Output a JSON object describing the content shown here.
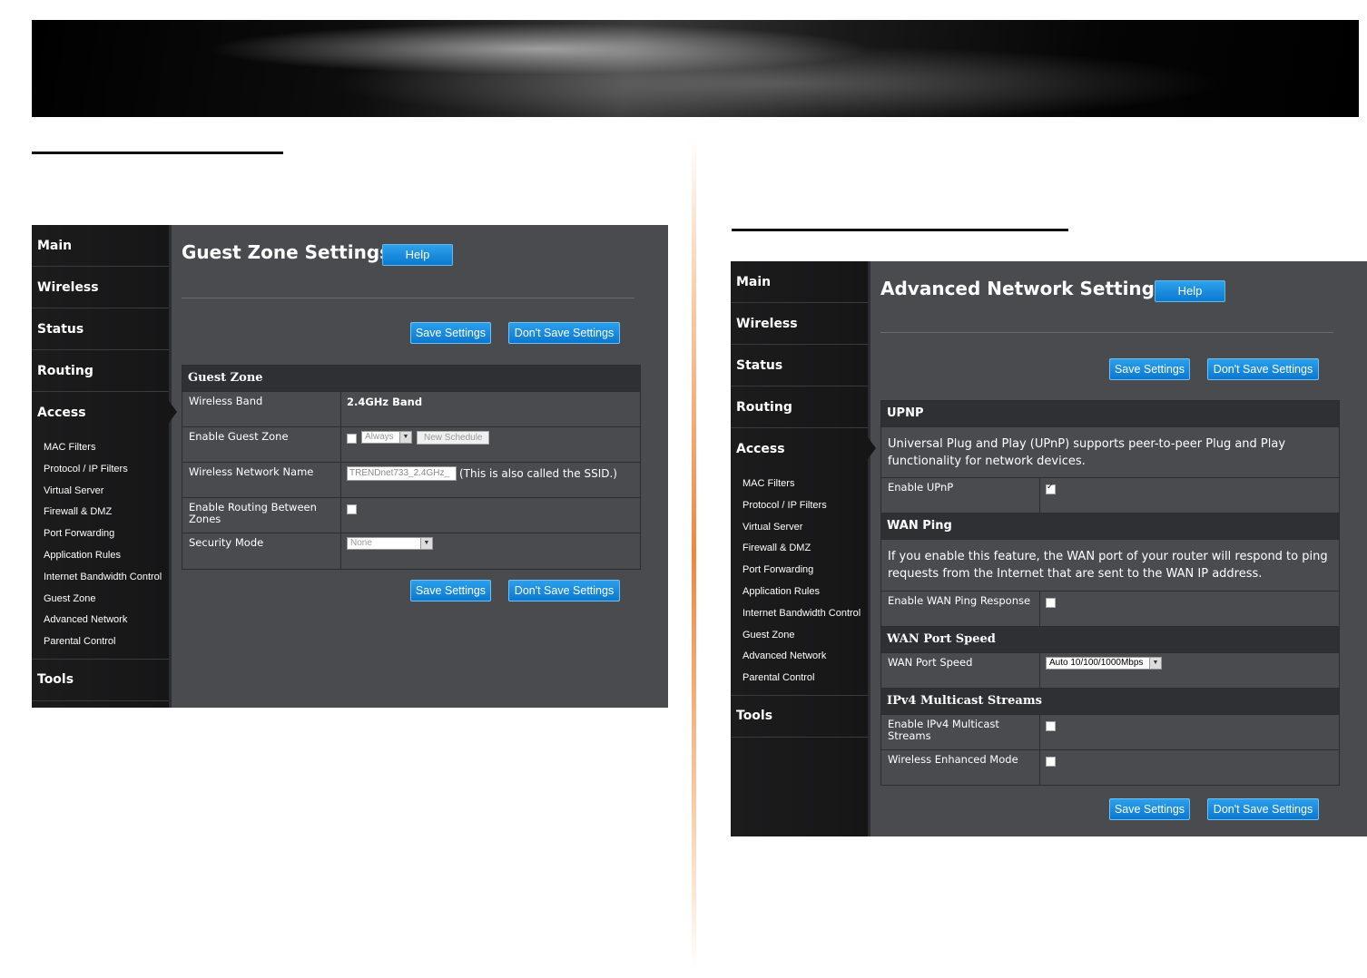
{
  "left_panel": {
    "nav": [
      "Main",
      "Wireless",
      "Status",
      "Routing",
      "Access"
    ],
    "access_items": [
      "MAC Filters",
      "Protocol / IP Filters",
      "Virtual Server",
      "Firewall & DMZ",
      "Port Forwarding",
      "Application Rules",
      "Internet Bandwidth Control",
      "Guest Zone",
      "Advanced Network",
      "Parental Control"
    ],
    "tools": "Tools",
    "title": "Guest Zone Settings",
    "help": "Help",
    "save": "Save Settings",
    "dont_save": "Don't Save Settings",
    "table": {
      "header": "Guest Zone",
      "rows": {
        "band_label": "Wireless Band",
        "band_value": "2.4GHz Band",
        "enable_label": "Enable Guest Zone",
        "schedule_value": "Always",
        "new_schedule": "New Schedule",
        "ssid_label": "Wireless Network Name",
        "ssid_value": "TRENDnet733_2.4GHz_",
        "ssid_note": "(This is also called the SSID.)",
        "routing_label": "Enable Routing Between Zones",
        "security_label": "Security Mode",
        "security_value": "None"
      }
    }
  },
  "right_panel": {
    "nav": [
      "Main",
      "Wireless",
      "Status",
      "Routing",
      "Access"
    ],
    "access_items": [
      "MAC Filters",
      "Protocol / IP Filters",
      "Virtual Server",
      "Firewall & DMZ",
      "Port Forwarding",
      "Application Rules",
      "Internet Bandwidth Control",
      "Guest Zone",
      "Advanced Network",
      "Parental Control"
    ],
    "tools": "Tools",
    "title": "Advanced Network Settings",
    "help": "Help",
    "save": "Save Settings",
    "dont_save": "Don't Save Settings",
    "upnp": {
      "header": "UPNP",
      "desc": "Universal Plug and Play (UPnP) supports peer-to-peer Plug and Play functionality for network devices.",
      "label": "Enable UPnP",
      "checked": true
    },
    "wan_ping": {
      "header": "WAN Ping",
      "desc": "If you enable this feature, the WAN port of your router will respond to ping requests from the Internet that are sent to the WAN IP address.",
      "label": "Enable WAN Ping Response",
      "checked": false
    },
    "wan_speed": {
      "header": "WAN Port Speed",
      "label": "WAN Port Speed",
      "value": "Auto 10/100/1000Mbps"
    },
    "multicast": {
      "header": "IPv4 Multicast Streams",
      "label1": "Enable IPv4 Multicast Streams",
      "label2": "Wireless Enhanced Mode"
    }
  },
  "colors": {
    "button": "#0b78cf",
    "panel_bg": "#4a4b4f",
    "sidebar_bg": "#161617",
    "divider": "#f07828"
  }
}
